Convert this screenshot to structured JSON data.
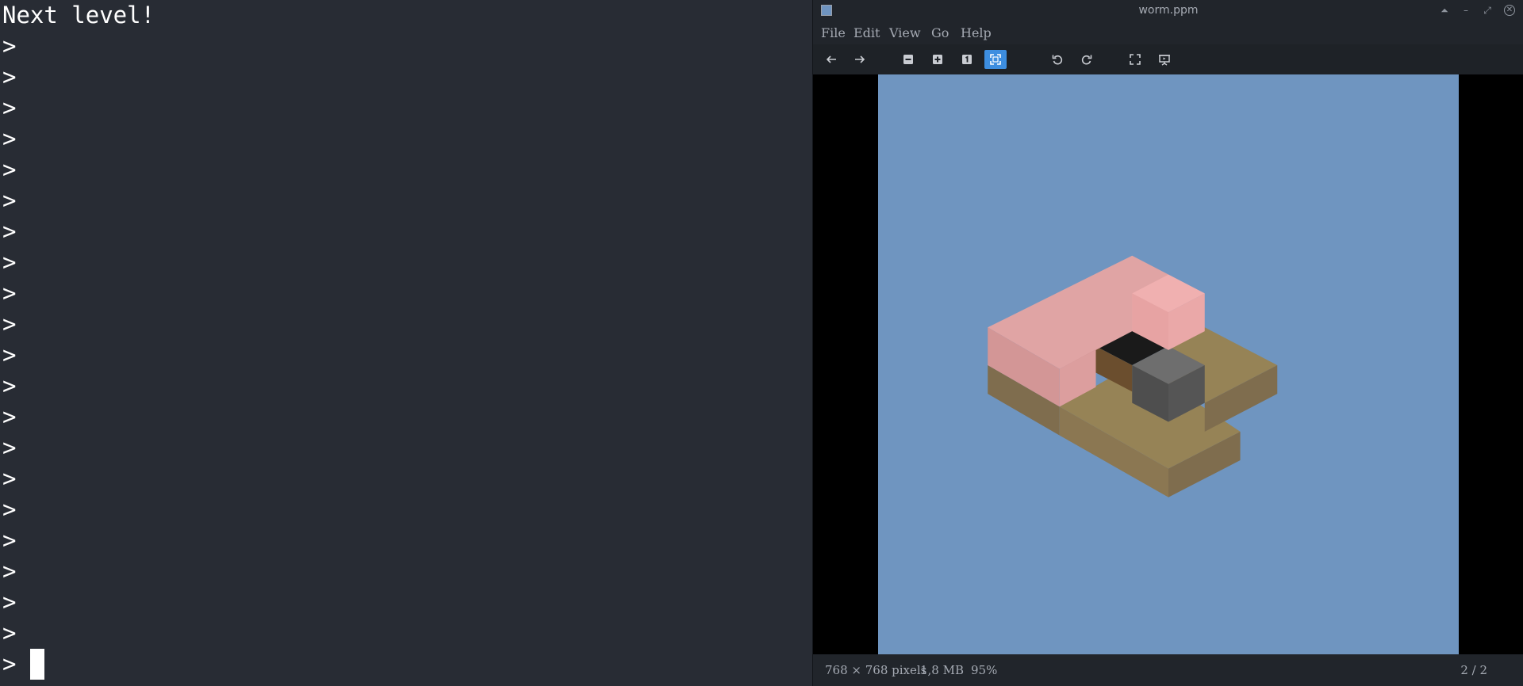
{
  "terminal": {
    "first_line": "Next level!",
    "prompt": ">",
    "empty_prompt_count": 20
  },
  "viewer": {
    "title": "worm.ppm",
    "menu": [
      "File",
      "Edit",
      "View",
      "Go",
      "Help"
    ],
    "toolbar": [
      {
        "name": "back-button",
        "icon": "arrow-left-icon",
        "active": false
      },
      {
        "name": "forward-button",
        "icon": "arrow-right-icon",
        "active": false
      },
      {
        "name": "zoom-out-button",
        "icon": "zoom-out-icon",
        "active": false
      },
      {
        "name": "zoom-in-button",
        "icon": "zoom-in-icon",
        "active": false
      },
      {
        "name": "normal-size-button",
        "icon": "one-to-one-icon",
        "active": false
      },
      {
        "name": "best-fit-button",
        "icon": "fit-icon",
        "active": true
      },
      {
        "name": "rotate-left-button",
        "icon": "rotate-left-icon",
        "active": false
      },
      {
        "name": "rotate-right-button",
        "icon": "rotate-right-icon",
        "active": false
      },
      {
        "name": "fullscreen-button",
        "icon": "fullscreen-icon",
        "active": false
      },
      {
        "name": "slideshow-button",
        "icon": "slideshow-icon",
        "active": false
      }
    ],
    "status": {
      "dimensions": "768 × 768 pixels",
      "size": "1,8 MB",
      "zoom": "95%",
      "position": "2 / 2"
    }
  },
  "colors": {
    "terminal_bg": "#282c34",
    "sky": "#6f95c0",
    "worm_pink": "#e4a7a7",
    "ground": "#968356",
    "rock": "#5e5e5e",
    "hole": "#1a1a1a",
    "accent": "#3d8ee0"
  }
}
